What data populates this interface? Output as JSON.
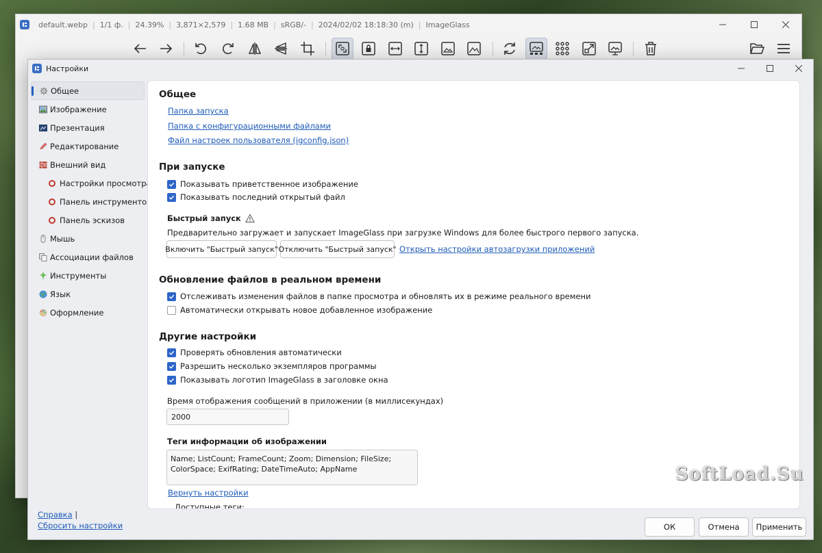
{
  "viewer": {
    "file_name": "default.webp",
    "page_index": "1/1 ф.",
    "zoom": "24.39%",
    "dimension": "3,871×2,579",
    "file_size": "1.68 MB",
    "color_space": "sRGB/-",
    "date_time": "2024/02/02 18:18:30 (m)",
    "app_name": "ImageGlass",
    "toolbar_icons": [
      "arrow-left-icon",
      "arrow-right-icon",
      "rotate-left-icon",
      "rotate-right-icon",
      "flip-horizontal-icon",
      "flip-vertical-icon",
      "crop-icon",
      "auto-zoom-icon",
      "lock-zoom-icon",
      "scale-width-icon",
      "scale-height-icon",
      "scale-to-fit-icon",
      "scale-to-fill-icon",
      "refresh-icon",
      "gallery-icon",
      "checkerboard-icon",
      "fullscreen-icon",
      "slideshow-icon",
      "delete-icon",
      "open-folder-icon",
      "menu-icon"
    ]
  },
  "settings": {
    "title": "Настройки",
    "nav": [
      {
        "label": "Общее",
        "icon": "gear-icon"
      },
      {
        "label": "Изображение",
        "icon": "image-icon"
      },
      {
        "label": "Презентация",
        "icon": "slideshow-icon"
      },
      {
        "label": "Редактирование",
        "icon": "pencil-icon"
      },
      {
        "label": "Внешний вид",
        "icon": "brick-icon"
      },
      {
        "label": "Настройки просмотра",
        "icon": "circle-icon"
      },
      {
        "label": "Панель инструментов",
        "icon": "circle-icon"
      },
      {
        "label": "Панель эскизов",
        "icon": "circle-icon"
      },
      {
        "label": "Мышь",
        "icon": "mouse-icon"
      },
      {
        "label": "Ассоциации файлов",
        "icon": "file-associations-icon"
      },
      {
        "label": "Инструменты",
        "icon": "tools-icon"
      },
      {
        "label": "Язык",
        "icon": "globe-icon"
      },
      {
        "label": "Оформление",
        "icon": "palette-icon"
      }
    ],
    "help_link": "Справка",
    "reset_link": "Сбросить настройки",
    "general": {
      "heading": "Общее",
      "links": [
        "Папка запуска",
        "Папка с конфигурационными файлами",
        "Файл настроек пользователя (igconfig.json)"
      ]
    },
    "startup": {
      "heading": "При запуске",
      "show_welcome": "Показывать приветственное изображение",
      "show_last_file": "Показывать последний открытый файл",
      "quick_start_title": "Быстрый запуск",
      "quick_start_desc": "Предварительно загружает и запускает ImageGlass при загрузке Windows для более быстрого первого запуска.",
      "enable_btn": "Включить \"Быстрый запуск\"",
      "disable_btn": "Отключить \"Быстрый запуск\"",
      "startup_apps_link": "Открыть настройки автозагрузки приложений"
    },
    "realtime": {
      "heading": "Обновление файлов в реальном времени",
      "watch_changes": "Отслеживать изменения файлов в папке просмотра и обновлять их в режиме реального времени",
      "auto_open_new": "Автоматически открывать новое добавленное изображение"
    },
    "other": {
      "heading": "Другие настройки",
      "check_updates": "Проверять обновления автоматически",
      "multi_instances": "Разрешить несколько экземпляров программы",
      "show_logo": "Показывать логотип ImageGlass в заголовке окна",
      "message_time_label": "Время отображения сообщений в приложении (в миллисекундах)",
      "message_time_value": "2000",
      "image_info_label": "Теги информации об изображении",
      "image_info_value": "Name; ListCount; FrameCount; Zoom; Dimension; FileSize; ColorSpace; ExifRating; DateTimeAuto; AppName",
      "reset_tags_link": "Вернуть настройки",
      "available_tags_label": "Доступные теги:"
    },
    "buttons": {
      "ok": "ОК",
      "cancel": "Отмена",
      "apply": "Применить"
    }
  },
  "watermark": "SoftLoad.Su",
  "colors": {
    "accent": "#2d65c8",
    "link": "#1e5bb8"
  }
}
